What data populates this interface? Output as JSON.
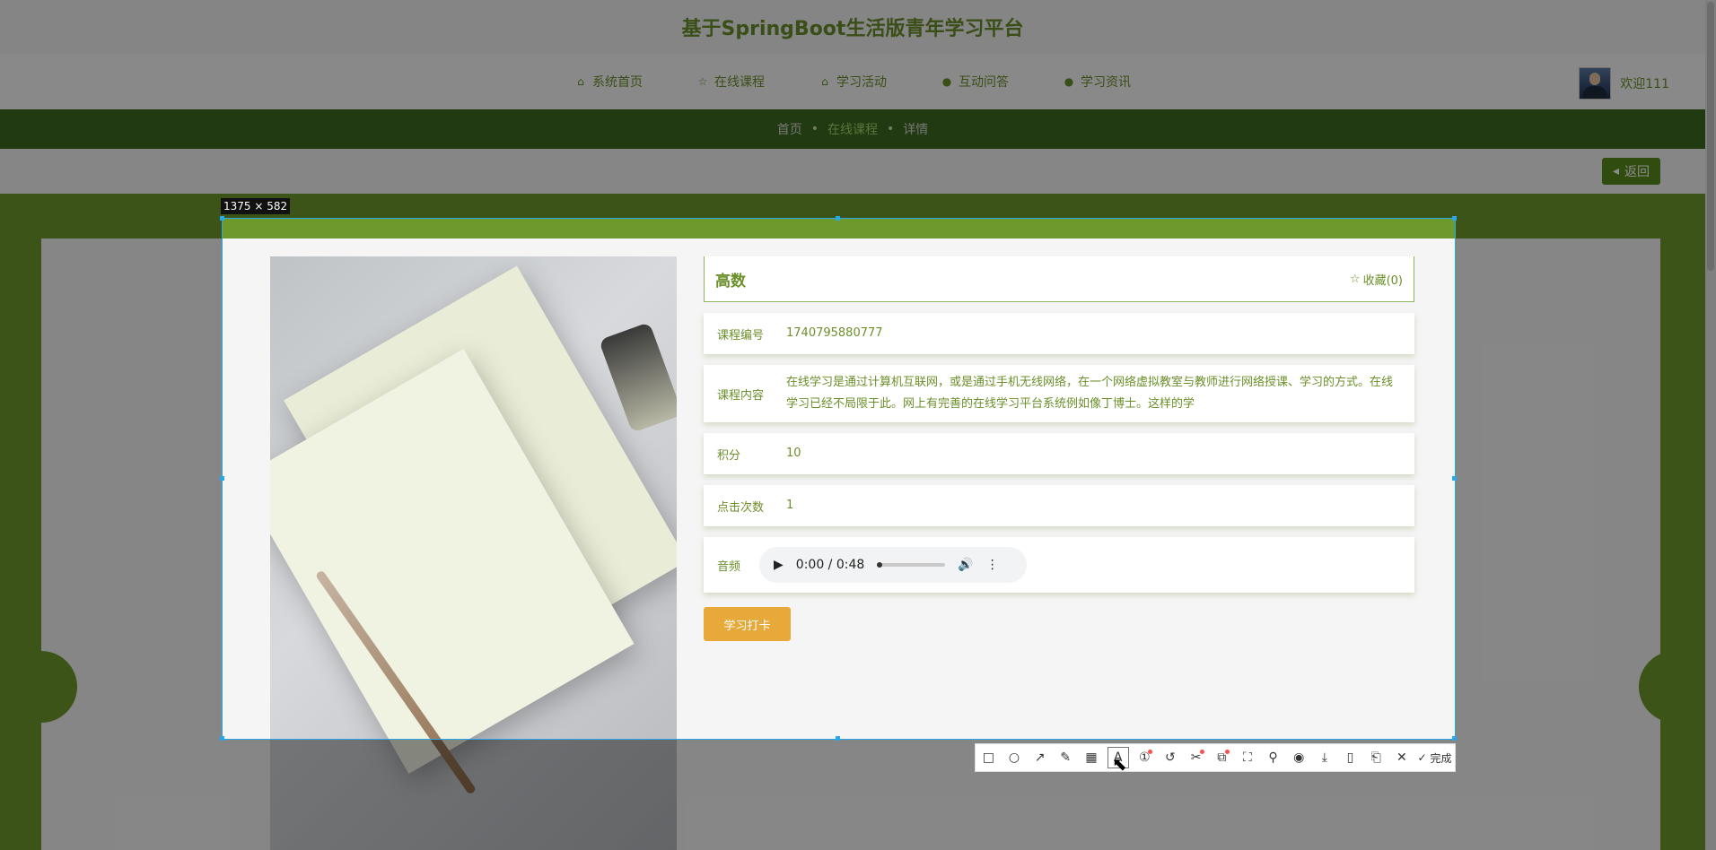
{
  "header": {
    "site_title": "基于SpringBoot生活版青年学习平台"
  },
  "nav": [
    {
      "label": "系统首页",
      "icon": "home-icon"
    },
    {
      "label": "在线课程",
      "icon": "star-icon"
    },
    {
      "label": "学习活动",
      "icon": "bag-icon"
    },
    {
      "label": "互动问答",
      "icon": "info-icon"
    },
    {
      "label": "学习资讯",
      "icon": "question-icon"
    }
  ],
  "user": {
    "welcome": "欢迎111"
  },
  "breadcrumb": {
    "home": "首页",
    "middle": "在线课程",
    "current": "详情"
  },
  "back_label": "返回",
  "course": {
    "name": "高数",
    "favorite": "收藏(0)",
    "fields": [
      {
        "label": "课程编号",
        "value": "1740795880777"
      },
      {
        "label": "课程内容",
        "value": "在线学习是通过计算机互联网，或是通过手机无线网络，在一个网络虚拟教室与教师进行网络授课、学习的方式。在线学习已经不局限于此。网上有完善的在线学习平台系统例如像丁博士。这样的学"
      },
      {
        "label": "积分",
        "value": "10"
      },
      {
        "label": "点击次数",
        "value": "1"
      }
    ],
    "audio_label": "音频",
    "audio_time": "0:00 / 0:48",
    "study_button": "学习打卡"
  },
  "screenshot_tool": {
    "size_label": "1375 × 582",
    "tools": [
      "rectangle-icon",
      "ellipse-icon",
      "arrow-icon",
      "pencil-icon",
      "mosaic-icon",
      "text-icon",
      "number-icon",
      "undo-icon",
      "scissors-icon",
      "translate-icon",
      "ocr-icon",
      "pin-icon",
      "record-icon",
      "download-icon",
      "phone-icon",
      "bookmark-icon",
      "close-icon"
    ],
    "done_label": "完成"
  },
  "colors": {
    "accent": "#6b8f2a",
    "nav_dark": "#3d6a1f",
    "band": "#6e9a2d",
    "study_button": "#e6a93a",
    "selection": "#2aa7e6"
  }
}
